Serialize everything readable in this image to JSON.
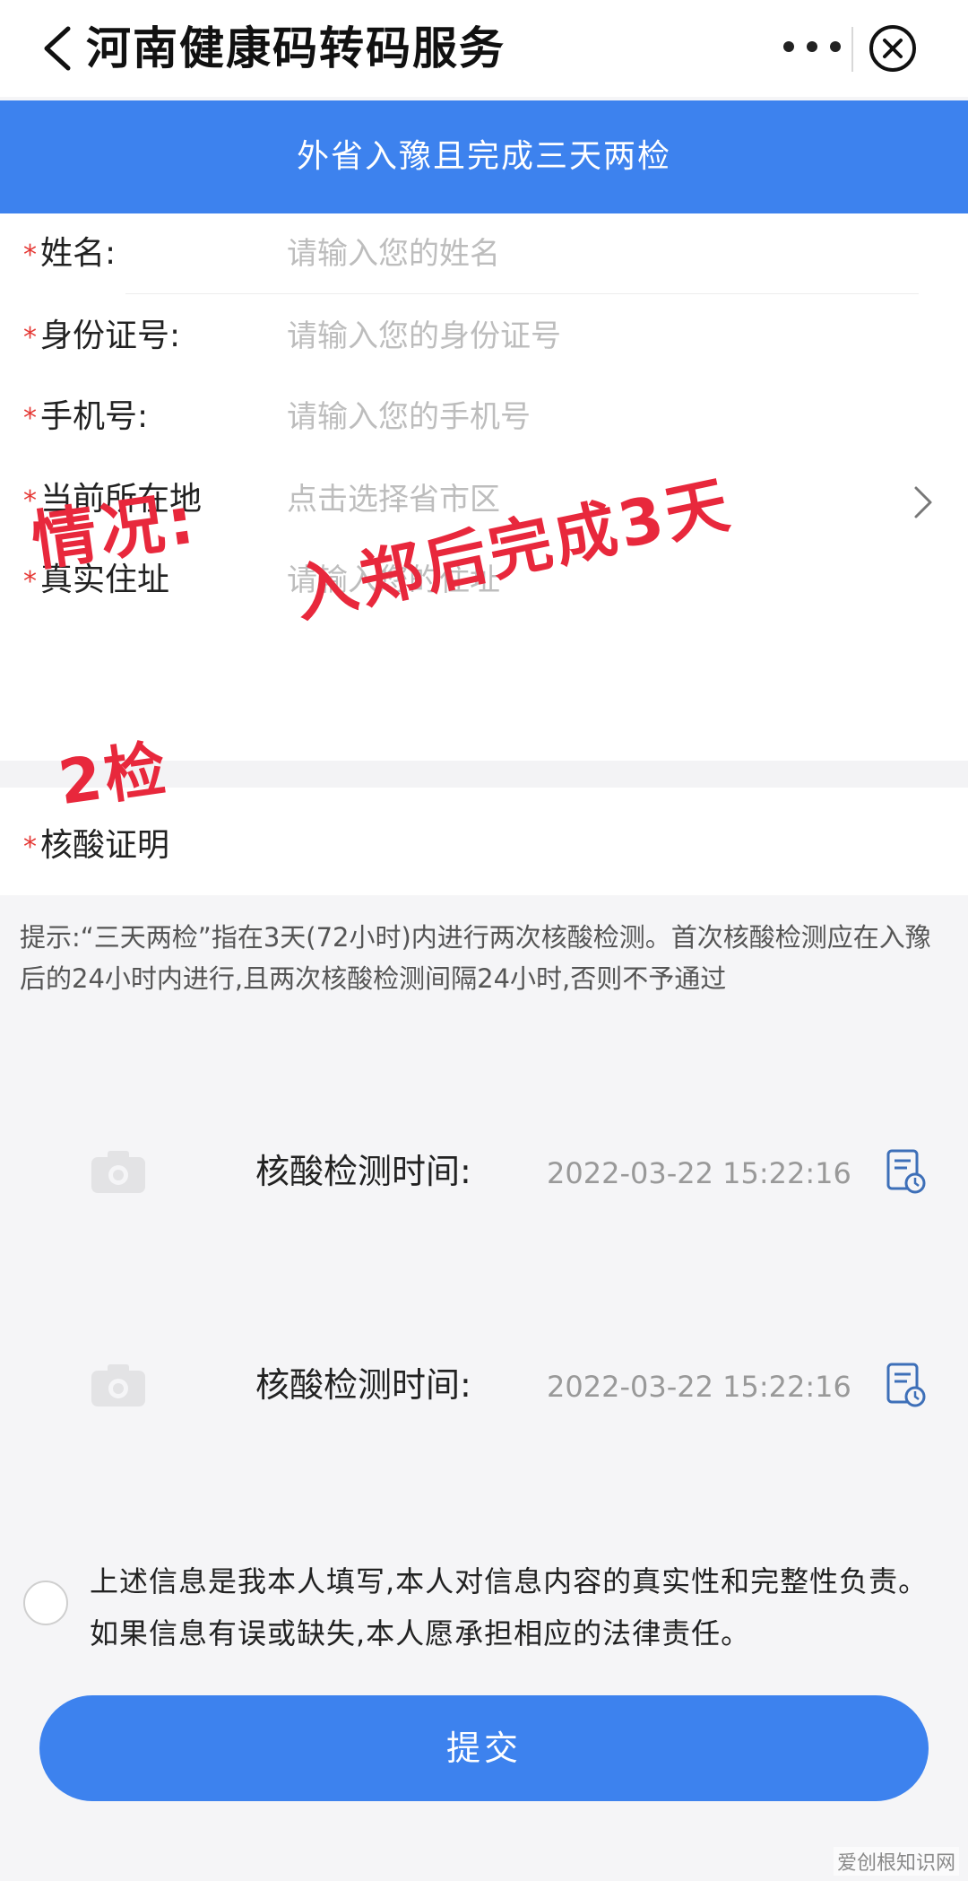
{
  "window": {
    "title": "河南健康码转码服务"
  },
  "banner": {
    "text": "外省入豫且完成三天两检"
  },
  "form": {
    "required_mark": "*",
    "fields": [
      {
        "label": "姓名:",
        "placeholder": "请输入您的姓名"
      },
      {
        "label": "身份证号:",
        "placeholder": "请输入您的身份证号"
      },
      {
        "label": "手机号:",
        "placeholder": "请输入您的手机号"
      },
      {
        "label": "当前所在地",
        "placeholder": "点击选择省市区"
      },
      {
        "label": "真实住址",
        "placeholder": "请输入您的住址"
      }
    ],
    "nucleic_label": "核酸证明"
  },
  "tip": "提示:“三天两检”指在3天(72小时)内进行两次核酸检测。首次核酸检测应在入豫后的24小时内进行,且两次核酸检测间隔24小时,否则不予通过",
  "records": [
    {
      "label": "核酸检测时间:",
      "time": "2022-03-22 15:22:16"
    },
    {
      "label": "核酸检测时间:",
      "time": "2022-03-22 15:22:16"
    }
  ],
  "agreement": {
    "text": "上述信息是我本人填写,本人对信息内容的真实性和完整性负责。如果信息有误或缺失,本人愿承担相应的法律责任。",
    "checked": false
  },
  "submit_label": "提交",
  "overlay": {
    "line1": "情况:",
    "line2": "入郑后完成3天",
    "line3": "2检"
  },
  "watermark": "爱创根知识网",
  "colors": {
    "accent": "#3d82ee",
    "required": "#e53935",
    "overlay": "#e8283c"
  }
}
